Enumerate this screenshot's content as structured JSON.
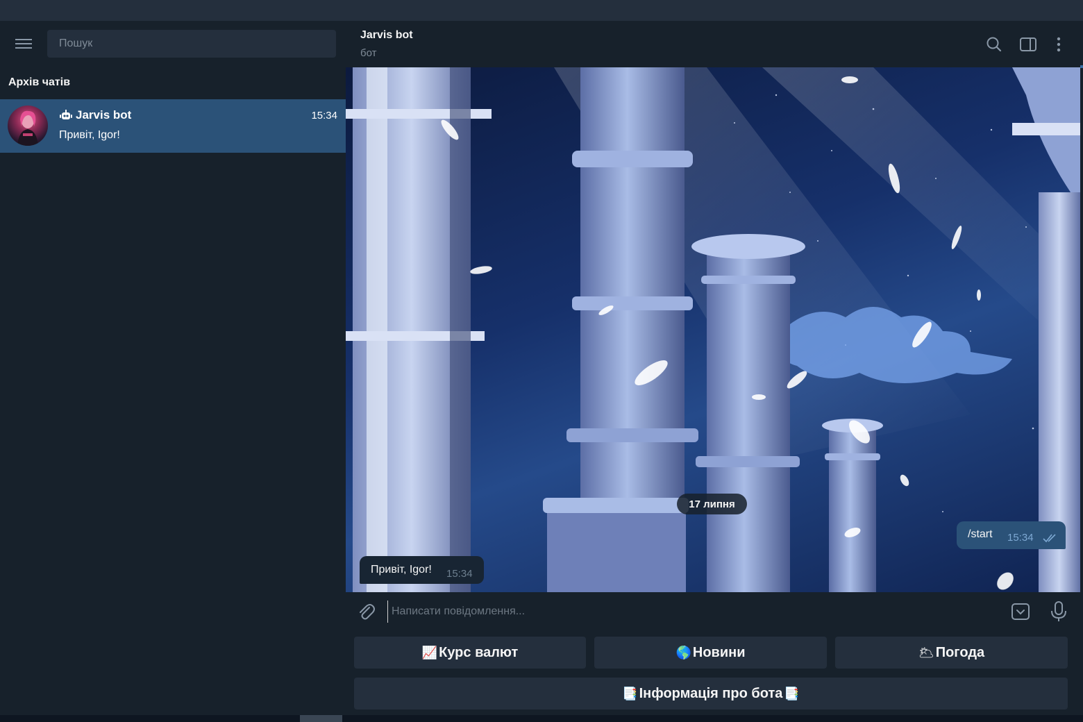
{
  "sidebar": {
    "search_placeholder": "Пошук",
    "section_title": "Архів чатів",
    "chats": [
      {
        "name": "Jarvis bot",
        "time": "15:34",
        "preview": "Привіт, Igor!",
        "is_bot": true,
        "selected": true
      }
    ]
  },
  "header": {
    "title": "Jarvis bot",
    "subtitle": "бот"
  },
  "conversation": {
    "date_separator": "17 липня",
    "messages": [
      {
        "direction": "out",
        "text": "/start",
        "time": "15:34",
        "status": "read"
      },
      {
        "direction": "in",
        "text": "Привіт, Igor!",
        "time": "15:34"
      }
    ]
  },
  "composer": {
    "placeholder": "Написати повідомлення..."
  },
  "reply_keyboard": {
    "rows": [
      [
        {
          "emoji": "📈",
          "label": "Курс валют"
        },
        {
          "emoji": "🌎",
          "label": "Новини"
        },
        {
          "emoji": "🌥",
          "label": "Погода"
        }
      ],
      [
        {
          "emoji": "📑",
          "label": "Інформація про бота",
          "emoji_after": "📑"
        }
      ]
    ]
  },
  "colors": {
    "sidebar_bg": "#17212b",
    "selected_chat": "#2b5278",
    "outgoing_bubble": "#2b5278",
    "incoming_bubble": "#182533",
    "keyboard_button": "#242f3d",
    "titlebar": "#242f3d"
  },
  "icons": [
    "menu-icon",
    "bot-icon",
    "search-icon",
    "sidebar-toggle-icon",
    "more-icon",
    "attach-icon",
    "keyboard-icon",
    "microphone-icon",
    "read-ticks-icon"
  ]
}
